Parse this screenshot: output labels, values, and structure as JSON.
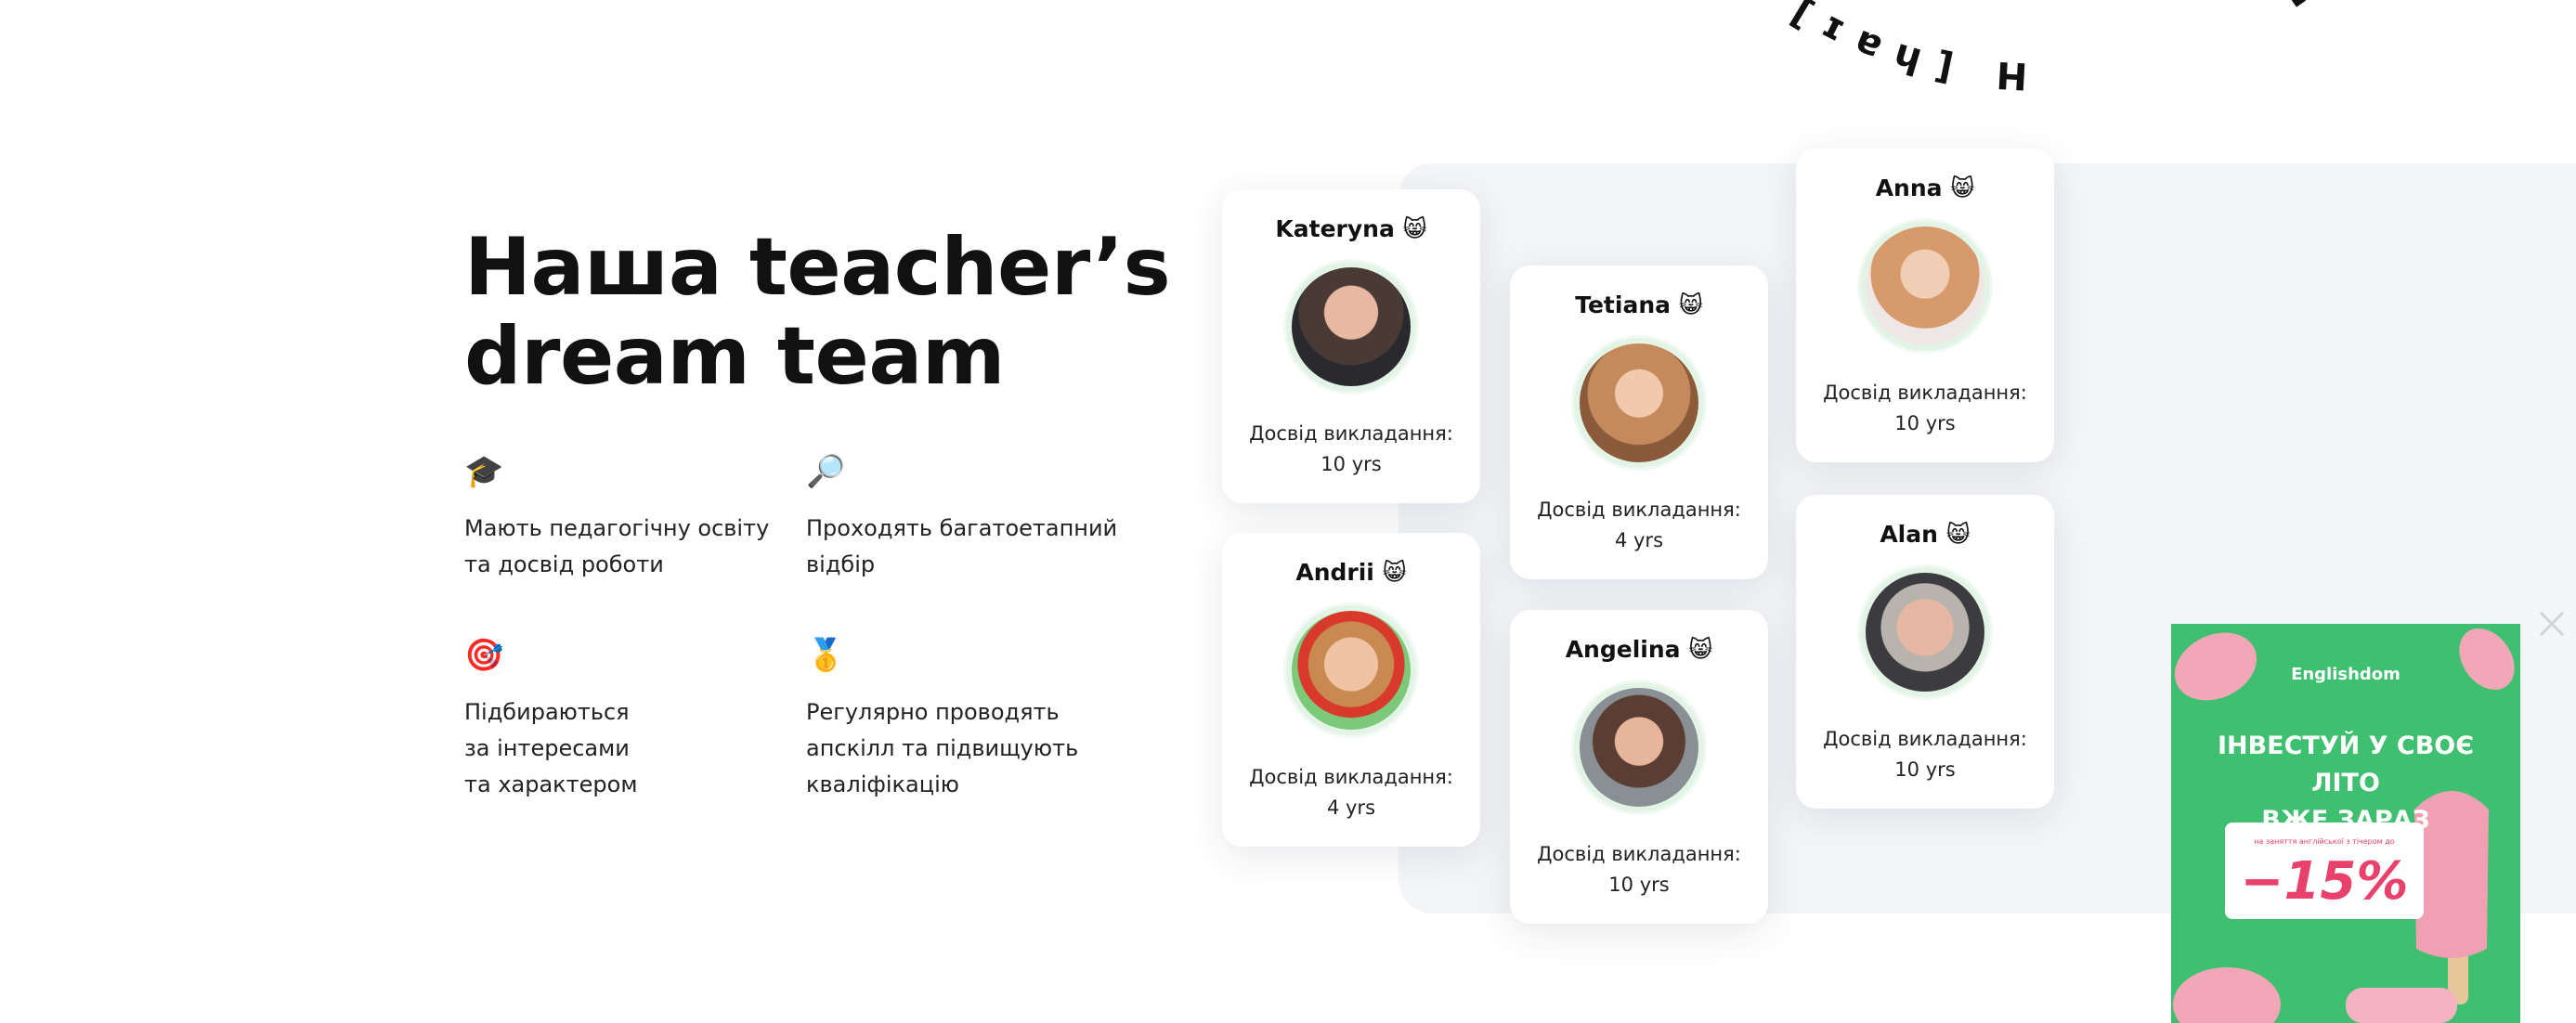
{
  "hero": {
    "title_line1": "Наша teacher’s",
    "title_line2": "dream team"
  },
  "features": [
    {
      "icon": "graduation-cap-icon",
      "emoji": "🎓",
      "text": "Мають педагогічну освіту\nта досвід роботи"
    },
    {
      "icon": "magnifier-icon",
      "emoji": "🔎",
      "text": "Проходять багатоетапний\nвідбір"
    },
    {
      "icon": "target-icon",
      "emoji": "🎯",
      "text": "Підбираються\nза інтересами\nта характером"
    },
    {
      "icon": "medal-icon",
      "emoji": "🥇",
      "text": "Регулярно проводять\nапскілл та підвищують\nкваліфікацію"
    }
  ],
  "ring_text": "H [haɪ] how [haʊ] are [ə] you [juː] H [haɪ] how [haʊ] are [ə] you [juː] ",
  "teachers": [
    {
      "name": "Kateryna",
      "emoji": "😸",
      "experience_label": "Досвід викладання:",
      "experience": "10 yrs"
    },
    {
      "name": "Andrii",
      "emoji": "😸",
      "experience_label": "Досвід викладання:",
      "experience": "4 yrs"
    },
    {
      "name": "Tetiana",
      "emoji": "😸",
      "experience_label": "Досвід викладання:",
      "experience": "4 yrs"
    },
    {
      "name": "Angelina",
      "emoji": "😸",
      "experience_label": "Досвід викладання:",
      "experience": "10 yrs"
    },
    {
      "name": "Anna",
      "emoji": "😸",
      "experience_label": "Досвід викладання:",
      "experience": "10 yrs"
    },
    {
      "name": "Alan",
      "emoji": "😸",
      "experience_label": "Досвід викладання:",
      "experience": "10 yrs"
    }
  ],
  "promo": {
    "brand": "Englishdom",
    "headline_line1": "ІНВЕСТУЙ У СВОЄ ЛІТО",
    "headline_line2": "ВЖЕ ЗАРАЗ",
    "fine_print": "на заняття англійської з тічером до",
    "discount": "−15%",
    "close_icon": "close-icon"
  },
  "colors": {
    "text": "#111111",
    "panel": "#f3f5f8",
    "avatar_ring": "#e3f4e6",
    "promo_green": "#3fbf70",
    "promo_pink": "#e8416b"
  }
}
